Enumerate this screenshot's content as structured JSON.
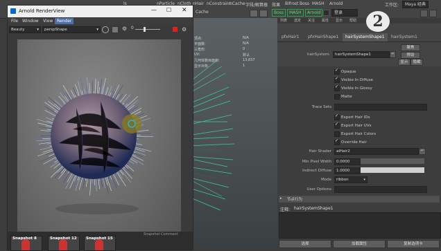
{
  "maya_menu": [
    "nParticle",
    "nCloth",
    "nHair",
    "nConstraint",
    "nCache",
    "字段/解算器",
    "效果",
    "Bifrost",
    "Boss",
    "MASH",
    "Arnold",
    "登录",
    "工作区:",
    "Maya 经典"
  ],
  "maya_menu_partial": [
    "ls",
    "Cache",
    "ds"
  ],
  "workspace_value": "Maya 经典",
  "shelf_tabs": [
    "Boss",
    "MASH",
    "Arnold"
  ],
  "login_label": "登录",
  "arnold": {
    "title": "Arnold RenderView",
    "menu": [
      "File",
      "Window",
      "View",
      "Render"
    ],
    "aov": "Beauty",
    "camera": "perspShape",
    "exposure": "0",
    "snapshots": [
      "Snapshot 8",
      "Snapshot 12",
      "Snapshot 15"
    ],
    "snapshot_comment": "Snapshot Comment"
  },
  "viewport_hud": [
    {
      "label": "顶点:",
      "value": "N/A"
    },
    {
      "label": "平面数:",
      "value": "N/A"
    },
    {
      "label": "三角形:",
      "value": "0"
    },
    {
      "label": "UV:",
      "value": "默认"
    },
    {
      "label": "几何体数目面积:",
      "value": "13,837"
    },
    {
      "label": "显示对象:",
      "value": "1"
    }
  ],
  "ae": {
    "tabs": [
      "pfxHair1",
      "pfxHairShape1",
      "hairSystemShape1",
      "hairSystem1"
    ],
    "active_tab": "hairSystemShape1",
    "header_links": [
      "列表",
      "选定",
      "关注",
      "属性",
      "显示",
      "帮助"
    ],
    "node_label": "hairSystem:",
    "node_value": "hairSystemShape1",
    "btn_focus": "聚焦",
    "btn_preset": "预设",
    "btn_show": "显示",
    "btn_hide": "隐藏",
    "checkboxes": [
      {
        "label": "Opaque",
        "checked": true
      },
      {
        "label": "Visible In Diffuse",
        "checked": true
      },
      {
        "label": "Visible In Glossy",
        "checked": true
      },
      {
        "label": "Matte",
        "checked": false
      }
    ],
    "trace_sets_label": "Trace Sets",
    "checkboxes2": [
      {
        "label": "Export Hair IDs",
        "checked": true
      },
      {
        "label": "Export Hair UVs",
        "checked": true
      },
      {
        "label": "Export Hair Colors",
        "checked": false
      },
      {
        "label": "Override Hair",
        "checked": true
      }
    ],
    "hair_shader_label": "Hair Shader",
    "hair_shader_value": "aiHair2",
    "min_pixel_label": "Min Pixel Width",
    "min_pixel_value": "0.0000",
    "indirect_diffuse_label": "Indirect Diffuse",
    "indirect_diffuse_value": "1.0000",
    "mode_label": "Mode",
    "mode_value": "ribbon",
    "user_options_label": "User Options",
    "section_label": "节点行为",
    "notes_label": "注释:",
    "notes_value": "hairSystemShape1",
    "btn_select": "选择",
    "btn_load_attrs": "加载属性",
    "btn_copy_tab": "复制选项卡"
  }
}
